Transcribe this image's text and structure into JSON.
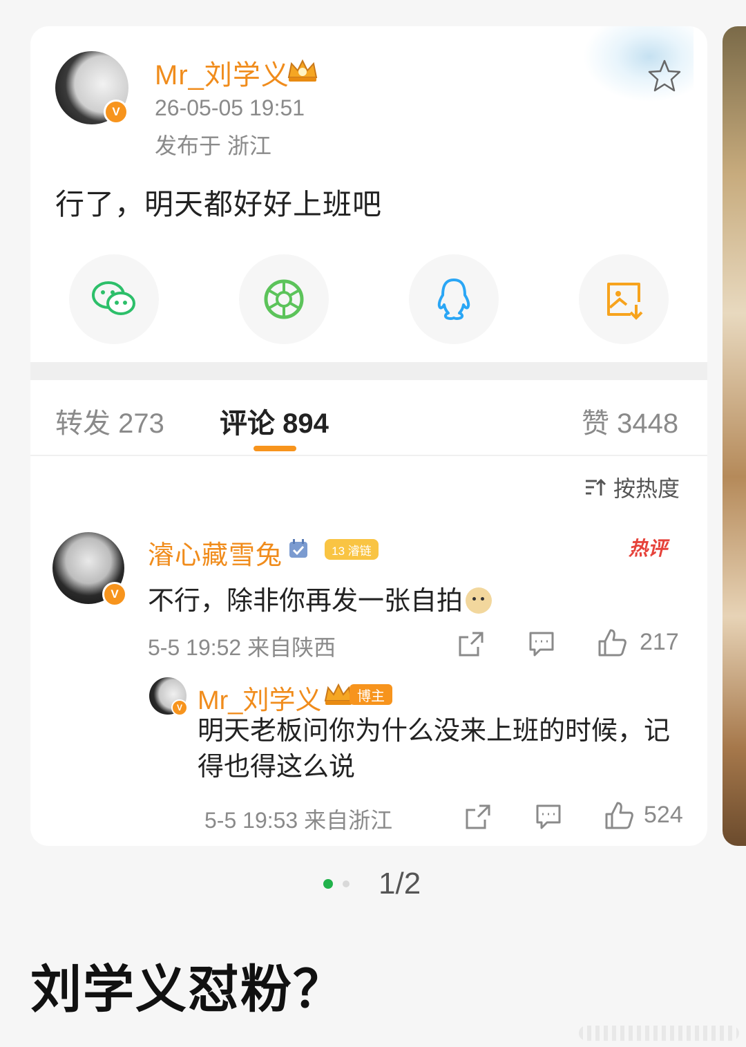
{
  "post": {
    "username": "Mr_刘学义",
    "date": "26-05-05 19:51",
    "location": "发布于 浙江",
    "text": "行了，明天都好好上班吧",
    "verified_badge": "V"
  },
  "share_buttons": [
    {
      "name": "wechat-icon",
      "color": "#2dbf6a"
    },
    {
      "name": "moments-icon",
      "color": "#5cc35a"
    },
    {
      "name": "qq-icon",
      "color": "#2aa6f5"
    },
    {
      "name": "save-image-icon",
      "color": "#f7a31d"
    }
  ],
  "tabs": {
    "repost": "转发 273",
    "comments": "评论 894",
    "likes": "赞 3448"
  },
  "sort_label": "按热度",
  "comment": {
    "username": "濬心藏雪兔",
    "fan_badge": "13 濬链",
    "hot_label": "热评",
    "text": "不行，除非你再发一张自拍",
    "meta": "5-5 19:52 来自陕西",
    "likes": "217"
  },
  "reply": {
    "username": "Mr_刘学义",
    "badge": "博主",
    "text": "明天老板问你为什么没来上班的时候，记得也得这么说",
    "meta": "5-5 19:53 来自浙江",
    "likes": "524"
  },
  "pager": "1/2",
  "headline": "刘学义怼粉？",
  "colors": {
    "accent": "#f7941d",
    "username": "#f08c1c",
    "hot": "#e6423a",
    "active_dot": "#21b24b"
  }
}
